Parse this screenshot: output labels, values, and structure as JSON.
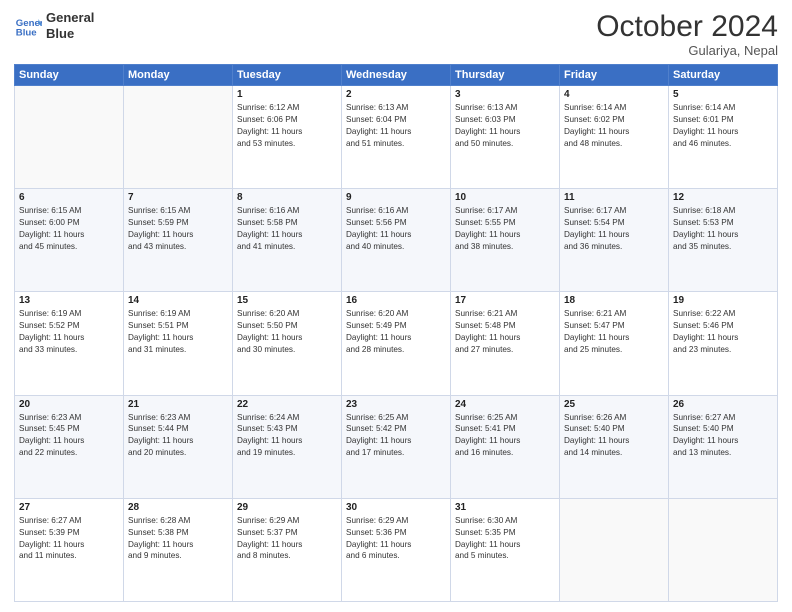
{
  "header": {
    "logo_line1": "General",
    "logo_line2": "Blue",
    "month": "October 2024",
    "location": "Gulariya, Nepal"
  },
  "days_of_week": [
    "Sunday",
    "Monday",
    "Tuesday",
    "Wednesday",
    "Thursday",
    "Friday",
    "Saturday"
  ],
  "weeks": [
    [
      {
        "day": "",
        "content": ""
      },
      {
        "day": "",
        "content": ""
      },
      {
        "day": "1",
        "content": "Sunrise: 6:12 AM\nSunset: 6:06 PM\nDaylight: 11 hours\nand 53 minutes."
      },
      {
        "day": "2",
        "content": "Sunrise: 6:13 AM\nSunset: 6:04 PM\nDaylight: 11 hours\nand 51 minutes."
      },
      {
        "day": "3",
        "content": "Sunrise: 6:13 AM\nSunset: 6:03 PM\nDaylight: 11 hours\nand 50 minutes."
      },
      {
        "day": "4",
        "content": "Sunrise: 6:14 AM\nSunset: 6:02 PM\nDaylight: 11 hours\nand 48 minutes."
      },
      {
        "day": "5",
        "content": "Sunrise: 6:14 AM\nSunset: 6:01 PM\nDaylight: 11 hours\nand 46 minutes."
      }
    ],
    [
      {
        "day": "6",
        "content": "Sunrise: 6:15 AM\nSunset: 6:00 PM\nDaylight: 11 hours\nand 45 minutes."
      },
      {
        "day": "7",
        "content": "Sunrise: 6:15 AM\nSunset: 5:59 PM\nDaylight: 11 hours\nand 43 minutes."
      },
      {
        "day": "8",
        "content": "Sunrise: 6:16 AM\nSunset: 5:58 PM\nDaylight: 11 hours\nand 41 minutes."
      },
      {
        "day": "9",
        "content": "Sunrise: 6:16 AM\nSunset: 5:56 PM\nDaylight: 11 hours\nand 40 minutes."
      },
      {
        "day": "10",
        "content": "Sunrise: 6:17 AM\nSunset: 5:55 PM\nDaylight: 11 hours\nand 38 minutes."
      },
      {
        "day": "11",
        "content": "Sunrise: 6:17 AM\nSunset: 5:54 PM\nDaylight: 11 hours\nand 36 minutes."
      },
      {
        "day": "12",
        "content": "Sunrise: 6:18 AM\nSunset: 5:53 PM\nDaylight: 11 hours\nand 35 minutes."
      }
    ],
    [
      {
        "day": "13",
        "content": "Sunrise: 6:19 AM\nSunset: 5:52 PM\nDaylight: 11 hours\nand 33 minutes."
      },
      {
        "day": "14",
        "content": "Sunrise: 6:19 AM\nSunset: 5:51 PM\nDaylight: 11 hours\nand 31 minutes."
      },
      {
        "day": "15",
        "content": "Sunrise: 6:20 AM\nSunset: 5:50 PM\nDaylight: 11 hours\nand 30 minutes."
      },
      {
        "day": "16",
        "content": "Sunrise: 6:20 AM\nSunset: 5:49 PM\nDaylight: 11 hours\nand 28 minutes."
      },
      {
        "day": "17",
        "content": "Sunrise: 6:21 AM\nSunset: 5:48 PM\nDaylight: 11 hours\nand 27 minutes."
      },
      {
        "day": "18",
        "content": "Sunrise: 6:21 AM\nSunset: 5:47 PM\nDaylight: 11 hours\nand 25 minutes."
      },
      {
        "day": "19",
        "content": "Sunrise: 6:22 AM\nSunset: 5:46 PM\nDaylight: 11 hours\nand 23 minutes."
      }
    ],
    [
      {
        "day": "20",
        "content": "Sunrise: 6:23 AM\nSunset: 5:45 PM\nDaylight: 11 hours\nand 22 minutes."
      },
      {
        "day": "21",
        "content": "Sunrise: 6:23 AM\nSunset: 5:44 PM\nDaylight: 11 hours\nand 20 minutes."
      },
      {
        "day": "22",
        "content": "Sunrise: 6:24 AM\nSunset: 5:43 PM\nDaylight: 11 hours\nand 19 minutes."
      },
      {
        "day": "23",
        "content": "Sunrise: 6:25 AM\nSunset: 5:42 PM\nDaylight: 11 hours\nand 17 minutes."
      },
      {
        "day": "24",
        "content": "Sunrise: 6:25 AM\nSunset: 5:41 PM\nDaylight: 11 hours\nand 16 minutes."
      },
      {
        "day": "25",
        "content": "Sunrise: 6:26 AM\nSunset: 5:40 PM\nDaylight: 11 hours\nand 14 minutes."
      },
      {
        "day": "26",
        "content": "Sunrise: 6:27 AM\nSunset: 5:40 PM\nDaylight: 11 hours\nand 13 minutes."
      }
    ],
    [
      {
        "day": "27",
        "content": "Sunrise: 6:27 AM\nSunset: 5:39 PM\nDaylight: 11 hours\nand 11 minutes."
      },
      {
        "day": "28",
        "content": "Sunrise: 6:28 AM\nSunset: 5:38 PM\nDaylight: 11 hours\nand 9 minutes."
      },
      {
        "day": "29",
        "content": "Sunrise: 6:29 AM\nSunset: 5:37 PM\nDaylight: 11 hours\nand 8 minutes."
      },
      {
        "day": "30",
        "content": "Sunrise: 6:29 AM\nSunset: 5:36 PM\nDaylight: 11 hours\nand 6 minutes."
      },
      {
        "day": "31",
        "content": "Sunrise: 6:30 AM\nSunset: 5:35 PM\nDaylight: 11 hours\nand 5 minutes."
      },
      {
        "day": "",
        "content": ""
      },
      {
        "day": "",
        "content": ""
      }
    ]
  ]
}
